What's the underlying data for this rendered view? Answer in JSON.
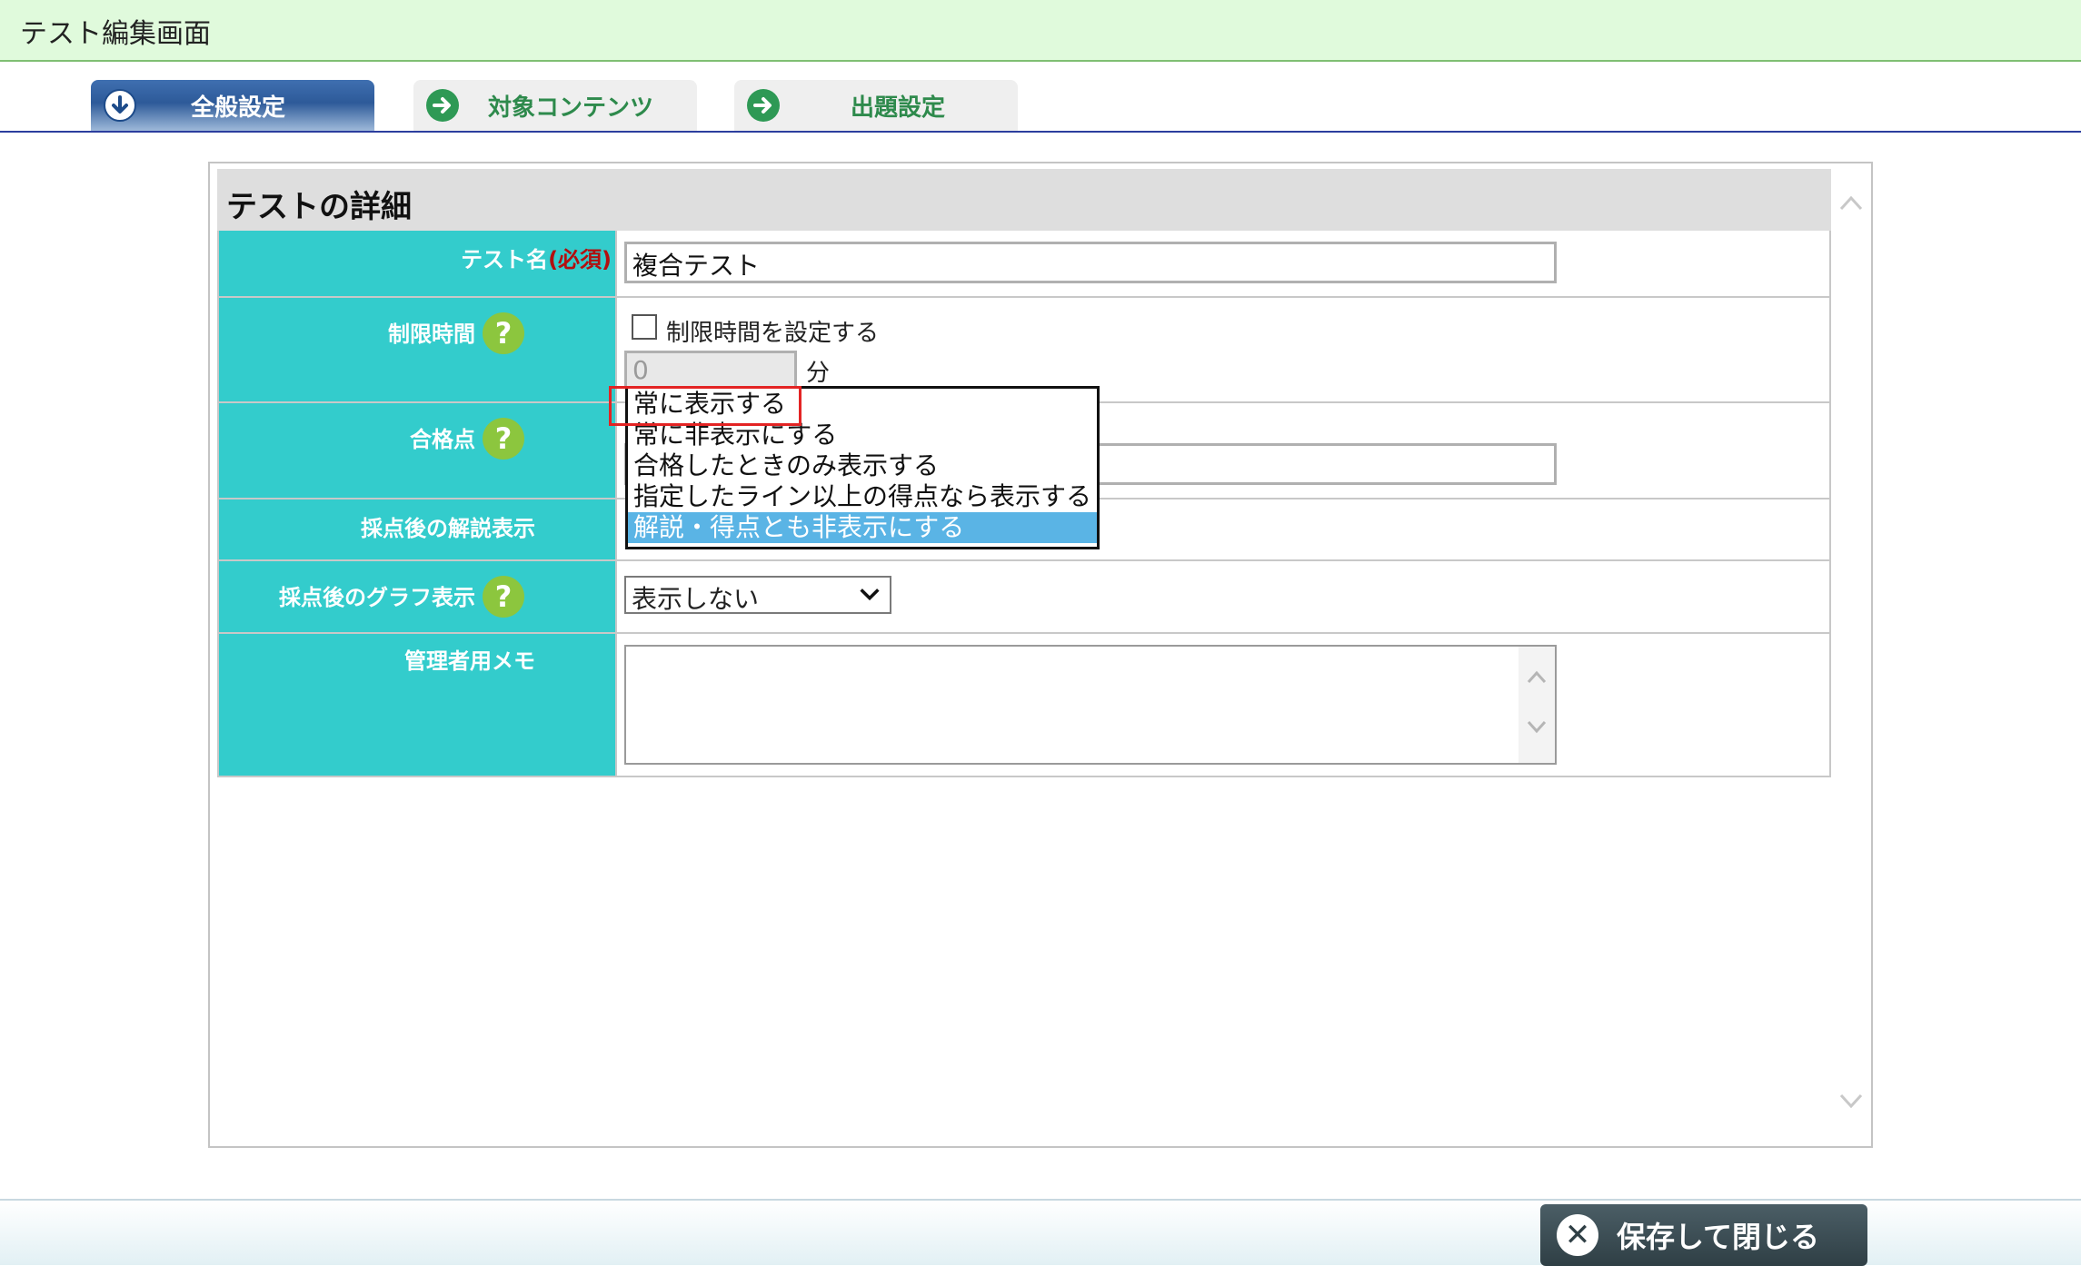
{
  "window": {
    "title": "テスト編集画面"
  },
  "tabs": [
    {
      "label": "全般設定",
      "icon": "arrow-down-circle-icon",
      "active": true
    },
    {
      "label": "対象コンテンツ",
      "icon": "arrow-right-circle-icon",
      "active": false
    },
    {
      "label": "出題設定",
      "icon": "arrow-right-circle-icon",
      "active": false
    }
  ],
  "section": {
    "title": "テストの詳細"
  },
  "form": {
    "test_name": {
      "label": "テスト名",
      "required": "(必須)",
      "value": "複合テスト"
    },
    "time_limit": {
      "label": "制限時間",
      "checkbox_label": "制限時間を設定する",
      "value": "0",
      "unit": "分"
    },
    "passing_score": {
      "label": "合格点"
    },
    "explanation_display": {
      "label": "採点後の解説表示"
    },
    "graph_display": {
      "label": "採点後のグラフ表示",
      "value": "表示しない"
    },
    "admin_memo": {
      "label": "管理者用メモ",
      "value": ""
    }
  },
  "dropdown": {
    "options": [
      "常に表示する",
      "常に非表示にする",
      "合格したときのみ表示する",
      "指定したライン以上の得点なら表示する",
      "解説・得点とも非表示にする"
    ],
    "selected_index": 4
  },
  "footer": {
    "save_close_label": "保存して閉じる"
  },
  "colors": {
    "label_bg": "#33cccc",
    "tab_active": "#2d5a99",
    "help_green": "#8cc63e",
    "select_highlight": "#5ab4e5"
  },
  "help_glyph": "?"
}
